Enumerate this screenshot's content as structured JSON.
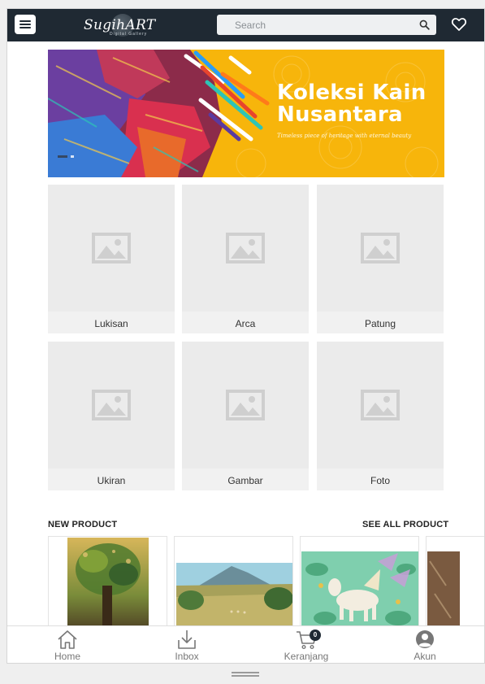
{
  "header": {
    "logo_text": "SugihART",
    "logo_subtext": "Digital Gallery",
    "search_placeholder": "Search"
  },
  "banner": {
    "title_line1": "Koleksi Kain",
    "title_line2": "Nusantara",
    "subtitle": "Timeless piece of heritage with eternal beauty",
    "accent_color": "#f7b50b"
  },
  "categories": [
    {
      "label": "Lukisan"
    },
    {
      "label": "Arca"
    },
    {
      "label": "Patung"
    },
    {
      "label": "Ukiran"
    },
    {
      "label": "Gambar"
    },
    {
      "label": "Foto"
    }
  ],
  "new_product": {
    "heading": "NEW PRODUCT",
    "see_all": "SEE ALL PRODUCT"
  },
  "bottom_nav": {
    "home": "Home",
    "inbox": "Inbox",
    "cart": "Keranjang",
    "cart_count": "0",
    "account": "Akun"
  },
  "colors": {
    "header_bg": "#1f2933",
    "placeholder_bg": "#ebebeb",
    "nav_text": "#777777"
  }
}
